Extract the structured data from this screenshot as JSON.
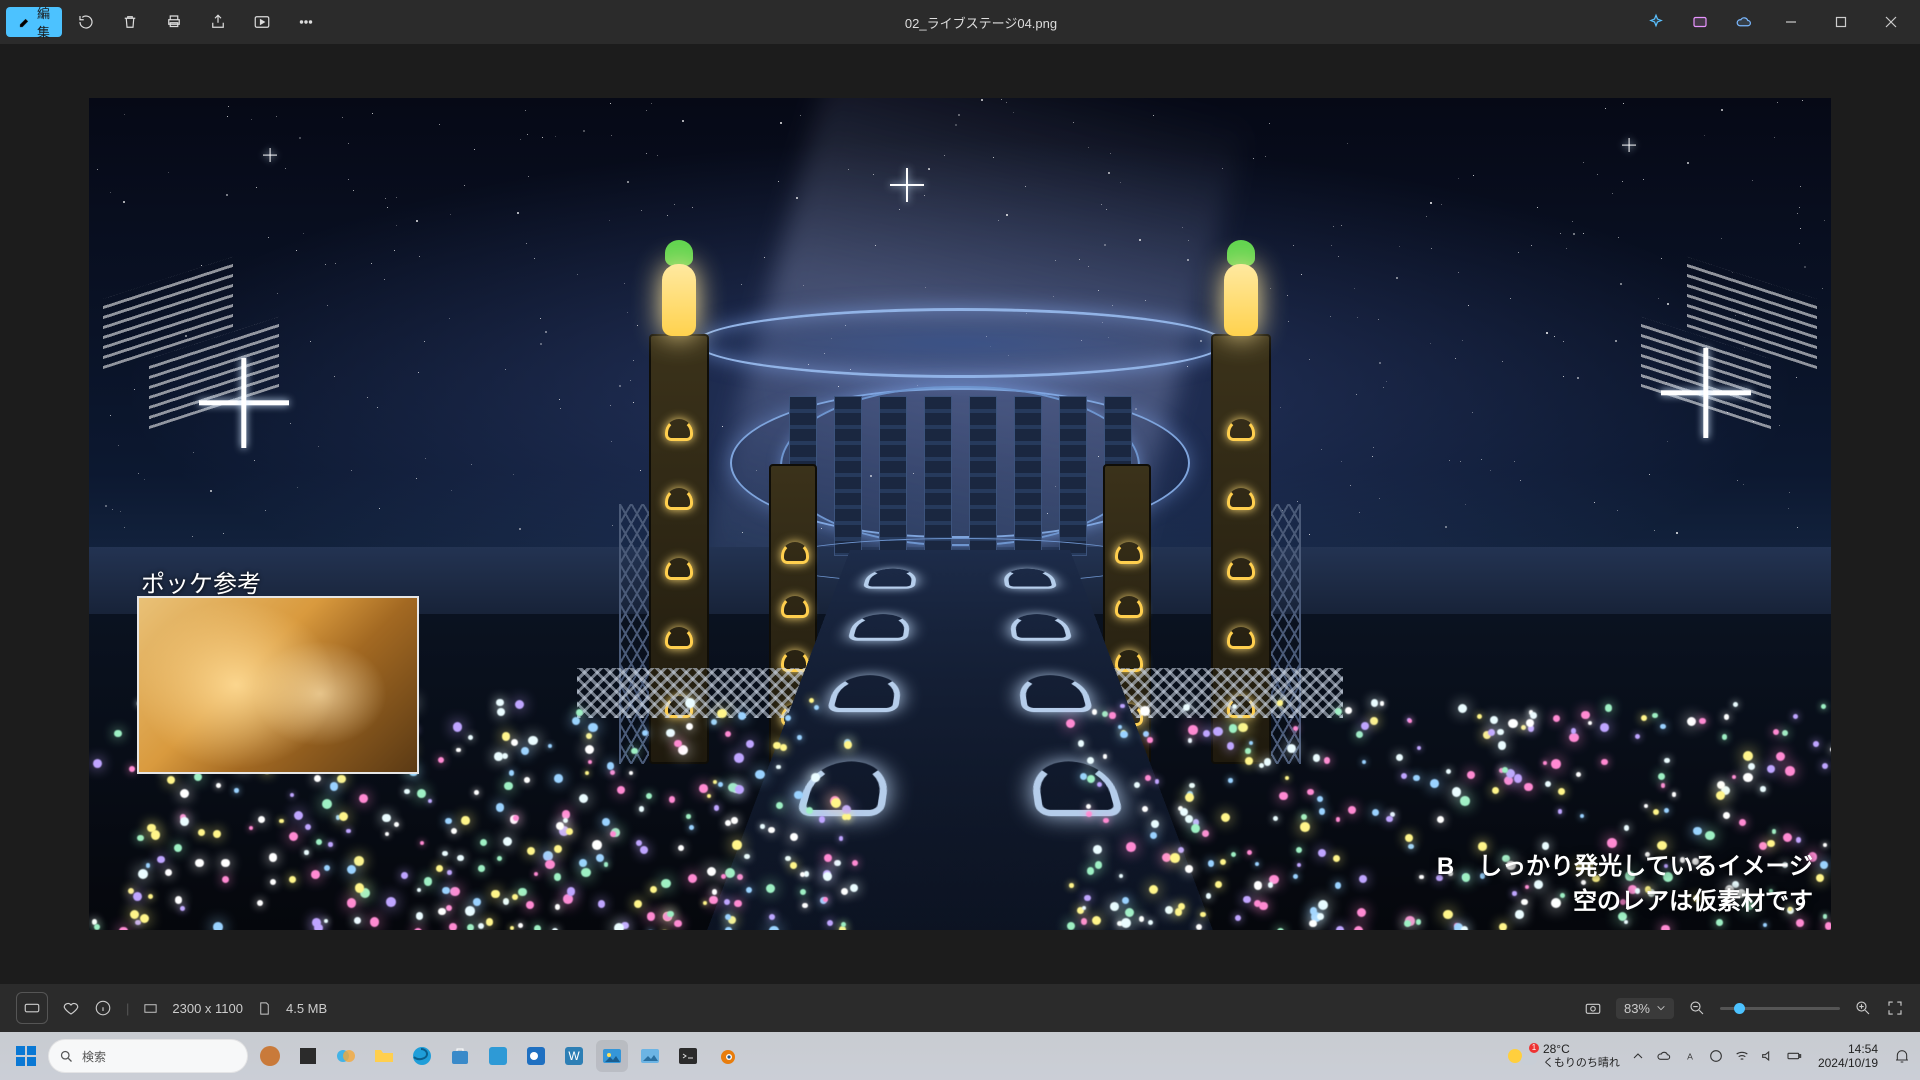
{
  "titlebar": {
    "edit": "編集",
    "filename": "02_ライブステージ04.png"
  },
  "overlay": {
    "ref_label": "ポッケ参考",
    "note_b_prefix": "B",
    "note_line1": "しっかり発光しているイメージ",
    "note_line2": "空のレアは仮素材です"
  },
  "status": {
    "dimensions": "2300 x 1100",
    "filesize": "4.5 MB",
    "zoom": "83%"
  },
  "taskbar": {
    "search_placeholder": "検索",
    "temp": "28°C",
    "weather": "くもりのち晴れ",
    "time": "14:54",
    "date": "2024/10/19"
  }
}
